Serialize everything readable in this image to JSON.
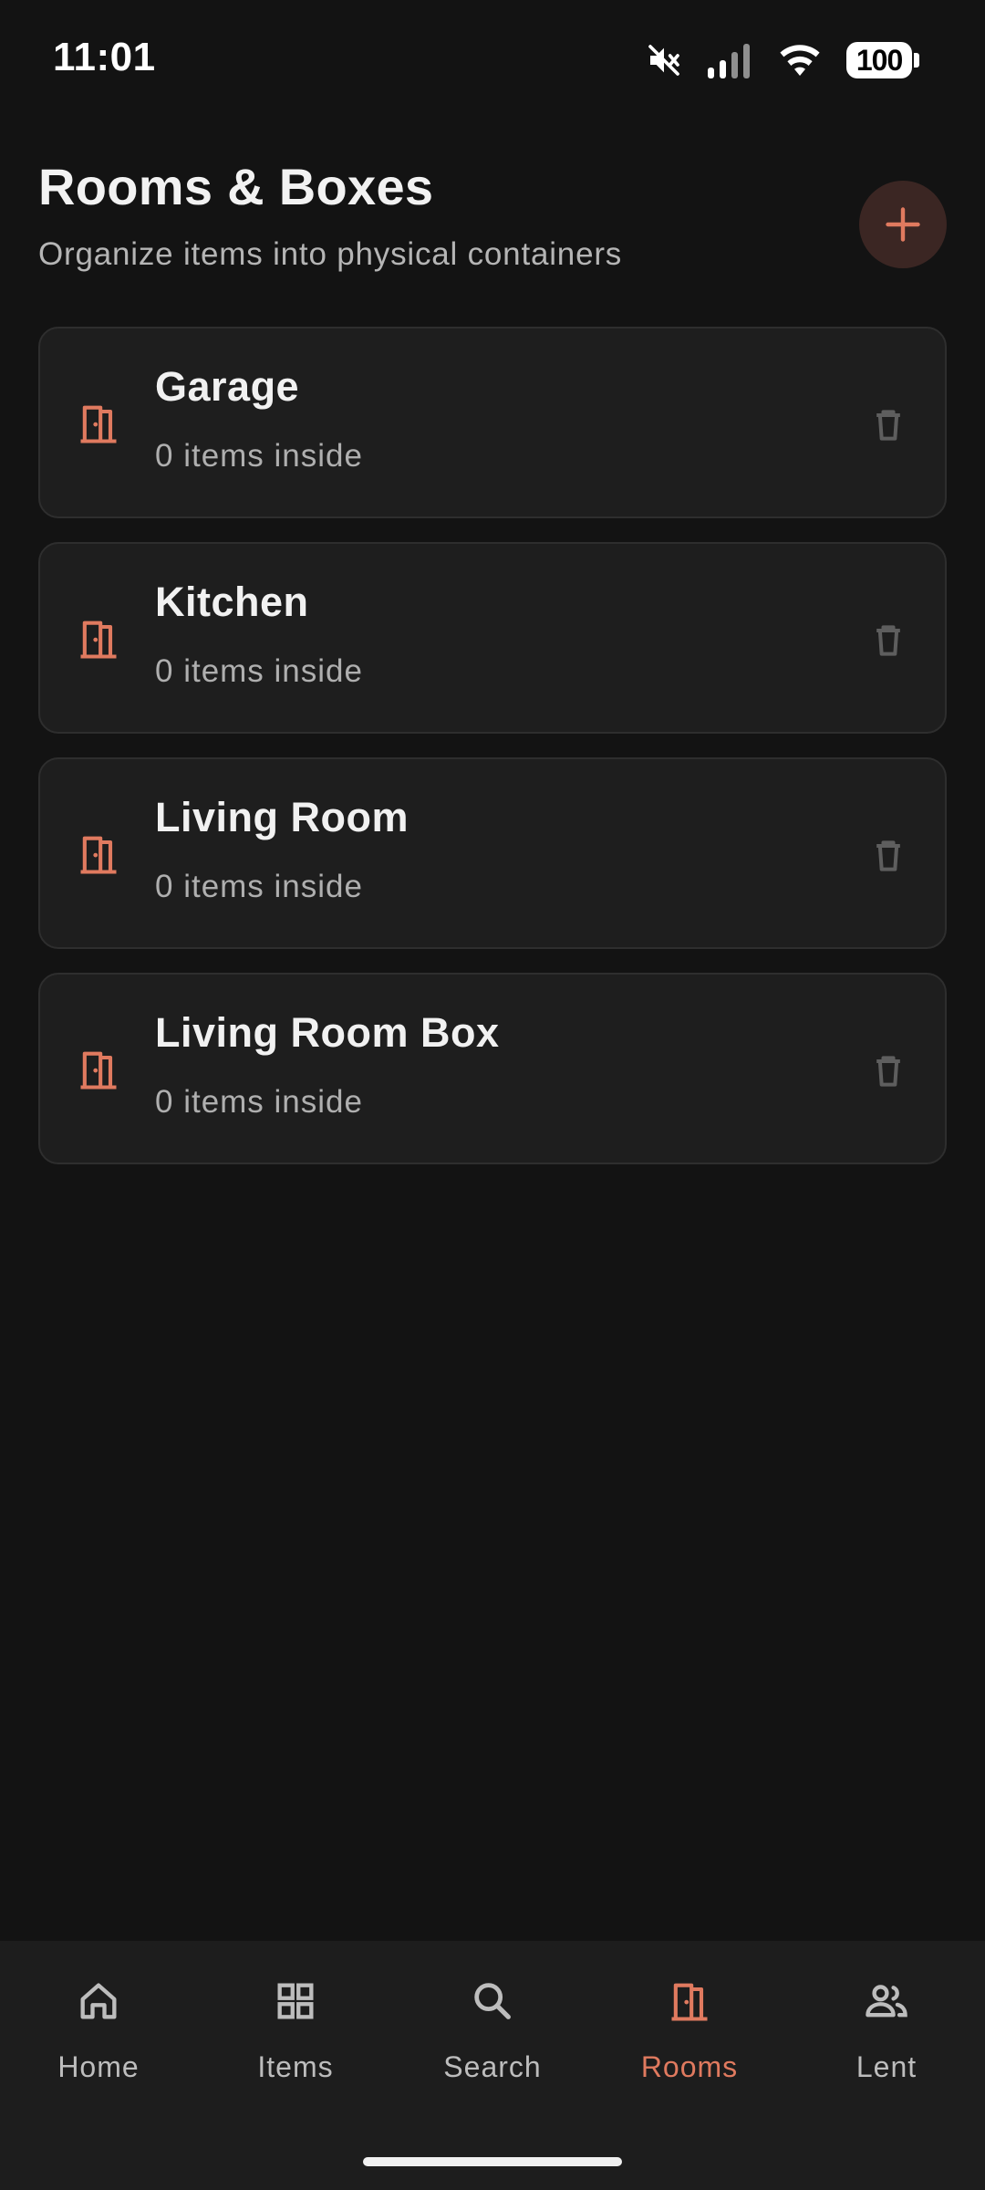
{
  "status_bar": {
    "time": "11:01",
    "battery": "100",
    "icons": [
      "mute-icon",
      "signal-icon",
      "wifi-icon",
      "battery-icon"
    ]
  },
  "header": {
    "title": "Rooms & Boxes",
    "subtitle": "Organize items into physical containers",
    "add_icon": "plus-icon"
  },
  "rooms": [
    {
      "name": "Garage",
      "count": "0 items inside"
    },
    {
      "name": "Kitchen",
      "count": "0 items inside"
    },
    {
      "name": "Living Room",
      "count": "0 items inside"
    },
    {
      "name": "Living Room Box",
      "count": "0 items inside"
    }
  ],
  "nav": {
    "items": [
      {
        "label": "Home",
        "icon": "home-icon"
      },
      {
        "label": "Items",
        "icon": "grid-icon"
      },
      {
        "label": "Search",
        "icon": "search-icon"
      },
      {
        "label": "Rooms",
        "icon": "door-icon",
        "active": true
      },
      {
        "label": "Lent",
        "icon": "people-icon"
      }
    ]
  },
  "colors": {
    "accent": "#E07A5F",
    "background": "#131313",
    "card": "#1E1E1E",
    "nav_background": "#1D1D1D"
  }
}
